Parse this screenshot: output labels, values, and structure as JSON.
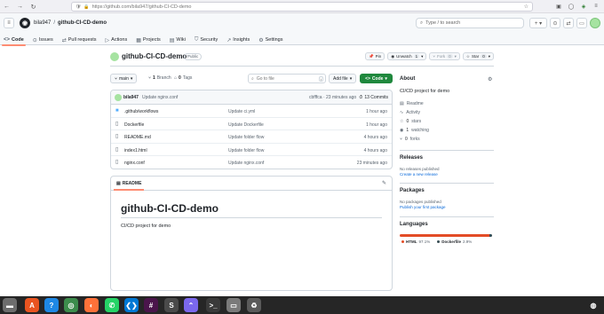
{
  "browser": {
    "url": "https://github.com/bila947/github-CI-CD-demo"
  },
  "header": {
    "owner": "bila947",
    "separator": "/",
    "repo": "github-CI-CD-demo",
    "search_placeholder": "Type / to search",
    "new_label": "+ ▾"
  },
  "tabs": [
    {
      "icon": "code-icon",
      "label": "Code"
    },
    {
      "icon": "issues-icon",
      "label": "Issues"
    },
    {
      "icon": "pull-request-icon",
      "label": "Pull requests"
    },
    {
      "icon": "actions-icon",
      "label": "Actions"
    },
    {
      "icon": "projects-icon",
      "label": "Projects"
    },
    {
      "icon": "wiki-icon",
      "label": "Wiki"
    },
    {
      "icon": "security-icon",
      "label": "Security"
    },
    {
      "icon": "insights-icon",
      "label": "Insights"
    },
    {
      "icon": "settings-icon",
      "label": "Settings"
    }
  ],
  "repo": {
    "name": "github-CI-CD-demo",
    "visibility": "Public",
    "pin": "Pin",
    "unwatch": "Unwatch",
    "unwatch_count": "1",
    "fork": "Fork",
    "fork_count": "0",
    "star": "Star",
    "star_count": "0"
  },
  "toolbar": {
    "branch": "main",
    "branch_count": "1",
    "branch_label": "Branch",
    "tag_count": "0",
    "tag_label": "Tags",
    "goto_placeholder": "Go to file",
    "goto_kbd": "t",
    "add_file": "Add file",
    "code": "Code"
  },
  "latest_commit": {
    "author": "bila947",
    "message": "Update nginx.conf",
    "hash_time": "cbfffca · 23 minutes ago",
    "commits": "13 Commits"
  },
  "files": [
    {
      "type": "dir",
      "name": ".github/workflows",
      "message": "Update ci.yml",
      "time": "1 hour ago"
    },
    {
      "type": "file",
      "name": "Dockerfile",
      "message": "Update Dockerfile",
      "time": "1 hour ago"
    },
    {
      "type": "file",
      "name": "README.md",
      "message": "Update folder flow",
      "time": "4 hours ago"
    },
    {
      "type": "file",
      "name": "index1.html",
      "message": "Update folder flow",
      "time": "4 hours ago"
    },
    {
      "type": "file",
      "name": "nginx.conf",
      "message": "Update nginx.conf",
      "time": "23 minutes ago"
    }
  ],
  "readme": {
    "tab": "README",
    "title": "github-CI-CD-demo",
    "body": "CI/CD project for demo"
  },
  "about": {
    "heading": "About",
    "description": "CI/CD project for demo",
    "readme": "Readme",
    "activity": "Activity",
    "stars_count": "0",
    "stars_label": "stars",
    "watching_count": "1",
    "watching_label": "watching",
    "forks_count": "0",
    "forks_label": "forks"
  },
  "releases": {
    "heading": "Releases",
    "none": "No releases published",
    "link": "Create a new release"
  },
  "packages": {
    "heading": "Packages",
    "none": "No packages published",
    "link": "Publish your first package"
  },
  "languages": {
    "heading": "Languages",
    "items": [
      {
        "name": "HTML",
        "percent": "97.1%",
        "value": 97.1,
        "color": "#e34c26"
      },
      {
        "name": "Dockerfile",
        "percent": "2.9%",
        "value": 2.9,
        "color": "#384d54"
      }
    ]
  },
  "colors": {
    "accent_green": "#1f883d",
    "link_blue": "#0969da",
    "tab_underline": "#fd8c73"
  },
  "taskbar": [
    {
      "icon": "trash-icon",
      "color": "#6d6d6d"
    },
    {
      "icon": "software-store-icon",
      "color": "#e95420"
    },
    {
      "icon": "help-icon",
      "color": "#1e88e5"
    },
    {
      "icon": "chrome-icon",
      "color": "#3c8c4c"
    },
    {
      "icon": "firefox-icon",
      "color": "#ff7139"
    },
    {
      "icon": "whatsapp-icon",
      "color": "#25d366"
    },
    {
      "icon": "vscode-icon",
      "color": "#0078d4"
    },
    {
      "icon": "slack-icon",
      "color": "#4a154b"
    },
    {
      "icon": "sublime-icon",
      "color": "#4a4a4a"
    },
    {
      "icon": "clickup-icon",
      "color": "#7b68ee"
    },
    {
      "icon": "terminal-icon",
      "color": "#3a3a3a"
    },
    {
      "icon": "files-icon",
      "color": "#7a7a7a"
    },
    {
      "icon": "recycle-icon",
      "color": "#5a5a5a"
    },
    {
      "icon": "ubuntu-icon",
      "color": "#262626"
    }
  ]
}
